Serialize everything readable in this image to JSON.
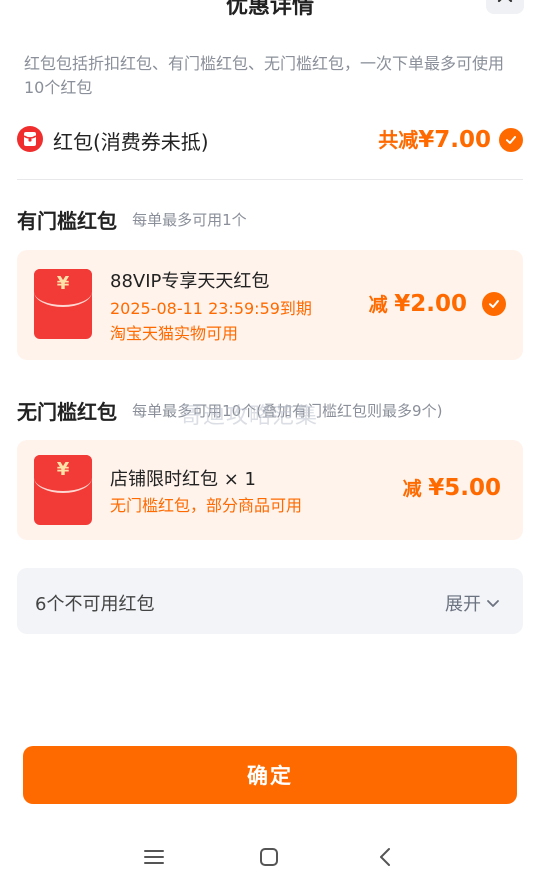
{
  "header": {
    "title": "优惠详情",
    "close_icon": "close-icon"
  },
  "intro": "红包包括折扣红包、有门槛红包、无门槛红包，一次下单最多可使用10个红包",
  "summary": {
    "label": "红包(消费券未抵)",
    "prefix": "共减",
    "amount": "¥7.00",
    "icon": "red-packet-icon",
    "checked": true
  },
  "threshold_section": {
    "title": "有门槛红包",
    "subtitle": "每单最多可用1个",
    "card": {
      "title": "88VIP专享天天红包",
      "expiry": "2025-08-11 23:59:59到期",
      "scope": "淘宝天猫实物可用",
      "reduce_prefix": "减",
      "amount": "¥2.00",
      "checked": true
    }
  },
  "no_threshold_section": {
    "title": "无门槛红包",
    "subtitle": "每单最多可用10个(叠加有门槛红包则最多9个)",
    "card": {
      "title": "店铺限时红包 × 1",
      "desc": "无门槛红包，部分商品可用",
      "reduce_prefix": "减",
      "amount": "¥5.00"
    }
  },
  "watermark": "哥迪攻略范集",
  "unusable": {
    "label": "6个不可用红包",
    "expand_label": "展开"
  },
  "confirm_label": "确定",
  "navbar": {
    "items": [
      "menu-icon",
      "home-icon",
      "back-icon"
    ]
  },
  "colors": {
    "accent": "#ff6a00",
    "red": "#f23b37",
    "card_bg": "#fff3ec"
  }
}
